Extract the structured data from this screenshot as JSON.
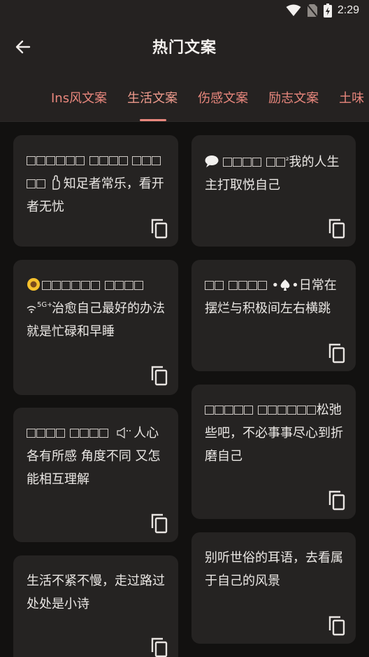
{
  "status_bar": {
    "time": "2:29"
  },
  "header": {
    "title": "热门文案"
  },
  "tabs": [
    {
      "label": "Ins风文案",
      "active": false
    },
    {
      "label": "生活文案",
      "active": true
    },
    {
      "label": "伤感文案",
      "active": false
    },
    {
      "label": "励志文案",
      "active": false
    },
    {
      "label": "土味",
      "active": false
    }
  ],
  "cards": [
    {
      "text_pre": "",
      "text": "知足者常乐，看开者无忧"
    },
    {
      "text_pre": "",
      "text": "我的人生 主打取悦自己"
    },
    {
      "text_pre": "治愈",
      "text": "自己最好的办法 就是忙碌和早睡"
    },
    {
      "text_pre": "",
      "text": "日常在摆烂与积极间左右横跳"
    },
    {
      "text_pre": "",
      "text": "人心各有所感 角度不同 又怎能相互理解"
    },
    {
      "text_pre": "",
      "text": "松弛些吧，不必事事尽心到折磨自己"
    },
    {
      "text_pre": "",
      "text": "生活不紧不慢，走过路过处处是小诗"
    },
    {
      "text_pre": "",
      "text": "别听世俗的耳语，去看属于自己的风景"
    }
  ],
  "colors": {
    "accent": "#e9877d",
    "card_bg": "#252322",
    "page_bg": "#121110",
    "bar_bg": "#252221"
  }
}
